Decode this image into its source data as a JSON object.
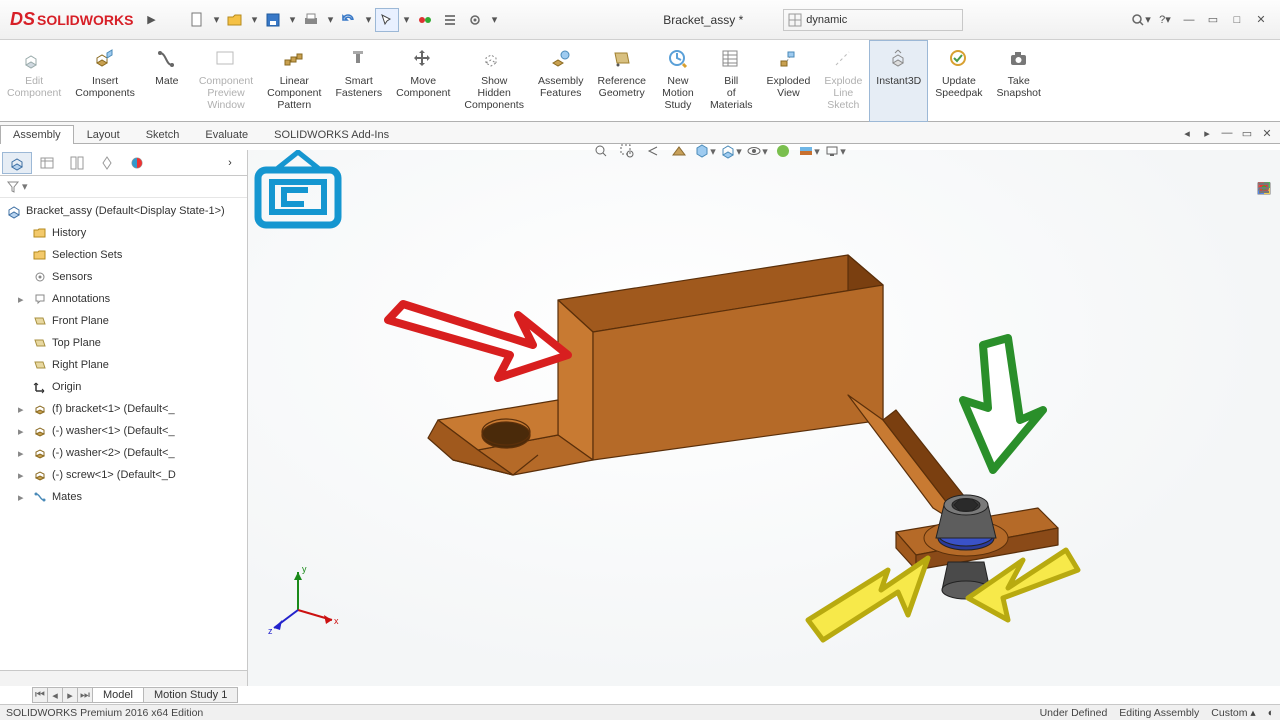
{
  "title": {
    "brand": "SOLIDWORKS",
    "doc": "Bracket_assy *",
    "search_value": "dynamic"
  },
  "ribbon": [
    {
      "label": "Edit Component",
      "disabled": true
    },
    {
      "label": "Insert Components"
    },
    {
      "label": "Mate"
    },
    {
      "label": "Component Preview Window",
      "disabled": true
    },
    {
      "label": "Linear Component Pattern"
    },
    {
      "label": "Smart Fasteners"
    },
    {
      "label": "Move Component"
    },
    {
      "label": "Show Hidden Components"
    },
    {
      "label": "Assembly Features"
    },
    {
      "label": "Reference Geometry"
    },
    {
      "label": "New Motion Study"
    },
    {
      "label": "Bill of Materials"
    },
    {
      "label": "Exploded View"
    },
    {
      "label": "Explode Line Sketch",
      "disabled": true
    },
    {
      "label": "Instant3D",
      "active": true
    },
    {
      "label": "Update Speedpak"
    },
    {
      "label": "Take Snapshot"
    }
  ],
  "tabs": [
    "Assembly",
    "Layout",
    "Sketch",
    "Evaluate",
    "SOLIDWORKS Add-Ins"
  ],
  "tree": {
    "root": "Bracket_assy  (Default<Display State-1>)",
    "items": [
      {
        "label": "History",
        "icon": "folder"
      },
      {
        "label": "Selection Sets",
        "icon": "folder"
      },
      {
        "label": "Sensors",
        "icon": "sensor"
      },
      {
        "label": "Annotations",
        "icon": "annot",
        "exp": true
      },
      {
        "label": "Front Plane",
        "icon": "plane"
      },
      {
        "label": "Top Plane",
        "icon": "plane"
      },
      {
        "label": "Right Plane",
        "icon": "plane"
      },
      {
        "label": "Origin",
        "icon": "origin"
      },
      {
        "label": "(f) bracket<1> (Default<<Default>_",
        "icon": "part",
        "exp": true
      },
      {
        "label": "(-) washer<1> (Default<<Default>_",
        "icon": "part",
        "exp": true
      },
      {
        "label": "(-) washer<2> (Default<<Default>_",
        "icon": "part",
        "exp": true
      },
      {
        "label": "(-) screw<1> (Default<<Default>_D",
        "icon": "part",
        "exp": true
      },
      {
        "label": "Mates",
        "icon": "mates",
        "exp": true
      }
    ]
  },
  "bottom_tabs": [
    "Model",
    "Motion Study 1"
  ],
  "status": {
    "edition": "SOLIDWORKS Premium 2016 x64 Edition",
    "under_defined": "Under Defined",
    "editing": "Editing Assembly",
    "units": "Custom"
  }
}
